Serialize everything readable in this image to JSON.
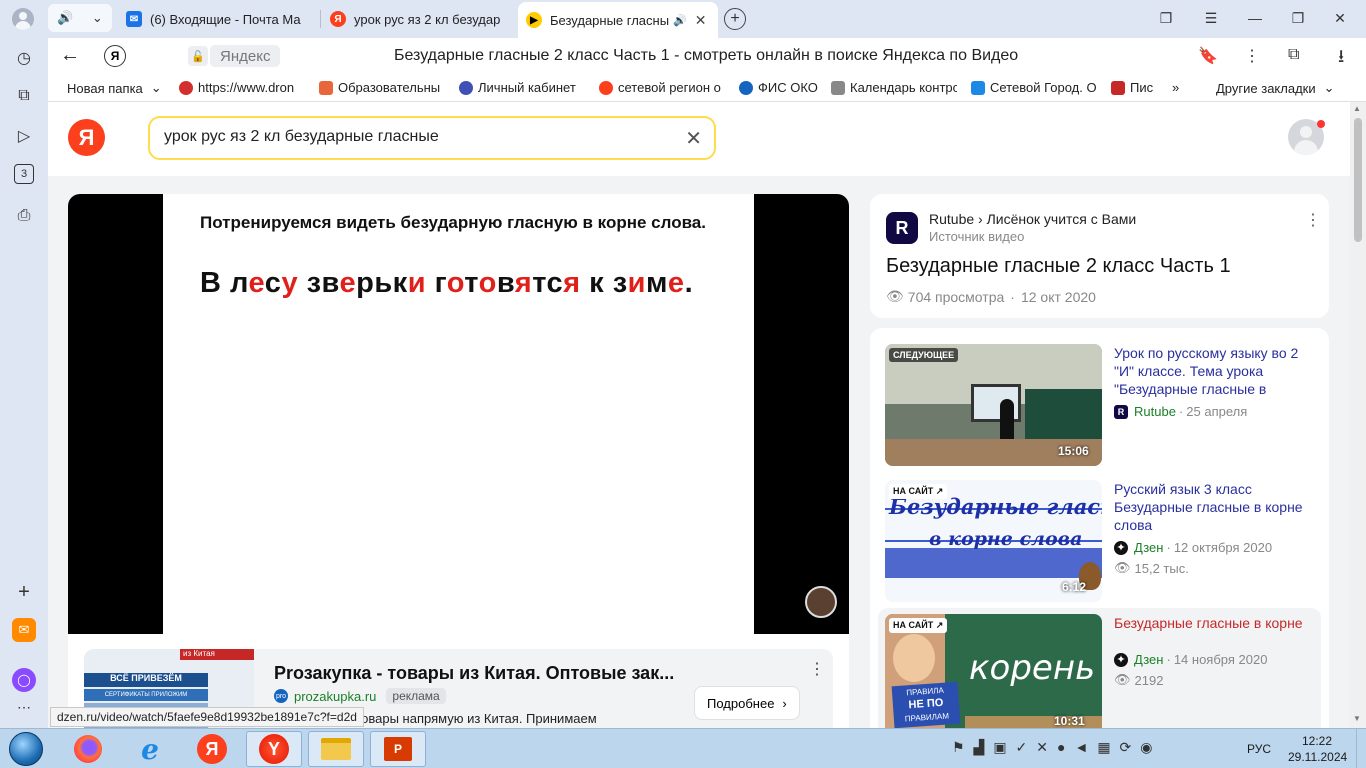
{
  "tabs": [
    {
      "label": "(6) Входящие - Почта Ма"
    },
    {
      "label": "урок рус яз 2 кл безудар"
    },
    {
      "label": "Безударные гласны"
    }
  ],
  "address": {
    "site": "Яндекс",
    "title": "Безударные гласные 2 класс Часть 1 - смотреть онлайн в поиске Яндекса по Видео"
  },
  "bookmarks": [
    {
      "label": "Новая папка",
      "color": "#ffffff"
    },
    {
      "label": "https://www.dron",
      "color": "#d32f2f"
    },
    {
      "label": "Образовательны",
      "color": "#e8673a"
    },
    {
      "label": "Личный кабинет",
      "color": "#3f51b5"
    },
    {
      "label": "сетевой регион о",
      "color": "#fc3f1d"
    },
    {
      "label": "ФИС ОКО",
      "color": "#1565c0"
    },
    {
      "label": "Календарь контро",
      "color": "#888888"
    },
    {
      "label": "Сетевой Город. О",
      "color": "#1e88e5"
    },
    {
      "label": "Пис",
      "color": "#c62828"
    }
  ],
  "bookmarks_other": "Другие закладки",
  "search": {
    "query": "урок рус яз 2 кл безударные гласные"
  },
  "video": {
    "slide_heading": "Потренируемся видеть безударную гласную в корне слова.",
    "sentence_parts": [
      {
        "t": "В л",
        "c": "#111111"
      },
      {
        "t": "е",
        "c": "#e0201b"
      },
      {
        "t": "с",
        "c": "#111111"
      },
      {
        "t": "у",
        "c": "#e0201b"
      },
      {
        "t": " зв",
        "c": "#111111"
      },
      {
        "t": "е",
        "c": "#e0201b"
      },
      {
        "t": "рьк",
        "c": "#111111"
      },
      {
        "t": "и",
        "c": "#e0201b"
      },
      {
        "t": " г",
        "c": "#111111"
      },
      {
        "t": "о",
        "c": "#e0201b"
      },
      {
        "t": "т",
        "c": "#111111"
      },
      {
        "t": "о",
        "c": "#e0201b"
      },
      {
        "t": "в",
        "c": "#111111"
      },
      {
        "t": "я",
        "c": "#e0201b"
      },
      {
        "t": "тс",
        "c": "#111111"
      },
      {
        "t": "я",
        "c": "#e0201b"
      },
      {
        "t": " к з",
        "c": "#111111"
      },
      {
        "t": "и",
        "c": "#e0201b"
      },
      {
        "t": "м",
        "c": "#111111"
      },
      {
        "t": "е",
        "c": "#e0201b"
      },
      {
        "t": ".",
        "c": "#111111"
      }
    ]
  },
  "ad": {
    "banner_top": "из Китая",
    "banner_headline": "ВСЁ ПРИВЕЗЁМ",
    "banner_line": "СЕРТИФИКАТЫ ПРИЛОЖИМ",
    "title": "Prозакупка - товары из Китая. Оптовые зак...",
    "domain": "prozakupka.ru",
    "badge": "реклама",
    "text": "Заказывайте товары напрямую из Китая. Принимаем",
    "button": "Подробнее"
  },
  "status_url": "dzen.ru/video/watch/5faefe9e8d19932be1891e7c?f=d2d",
  "info": {
    "source_name": "Rutube",
    "channel": "Лисёнок учится с Вами",
    "source_label": "Источник видео",
    "title": "Безударные гласные 2 класс Часть 1",
    "views": "704 просмотра",
    "date": "12 окт 2020"
  },
  "related": [
    {
      "badge": "СЛЕДУЮЩЕЕ",
      "duration": "15:06",
      "title": "Урок по русскому языку во 2 \"И\" классе. Тема урока \"Безударные гласные в",
      "source": "Rutube",
      "date": "25 апреля",
      "views": "",
      "title_color": "#2a2f9e"
    },
    {
      "badge": "НА САЙТ ↗",
      "duration": "6:12",
      "title": "Русский язык 3 класс Безударные гласные в корне слова",
      "source": "Дзен",
      "date": "12 октября 2020",
      "views": "15,2 тыс.",
      "title_color": "#2a2f9e"
    },
    {
      "badge": "НА САЙТ ↗",
      "duration": "10:31",
      "title": "Безударные гласные в корне",
      "source": "Дзен",
      "date": "14 ноября 2020",
      "views": "2192",
      "title_color": "#c62828"
    }
  ],
  "thumb_text": {
    "t2_line1": "Безударные гласные",
    "t2_line2": "в корне слова",
    "t3_word": "корень",
    "t3_sign1": "ПРАВИЛА",
    "t3_sign2": "НЕ ПО",
    "t3_sign3": "ПРАВИЛАМ"
  },
  "taskbar": {
    "lang": "РУС",
    "time": "12:22",
    "date": "29.11.2024"
  }
}
